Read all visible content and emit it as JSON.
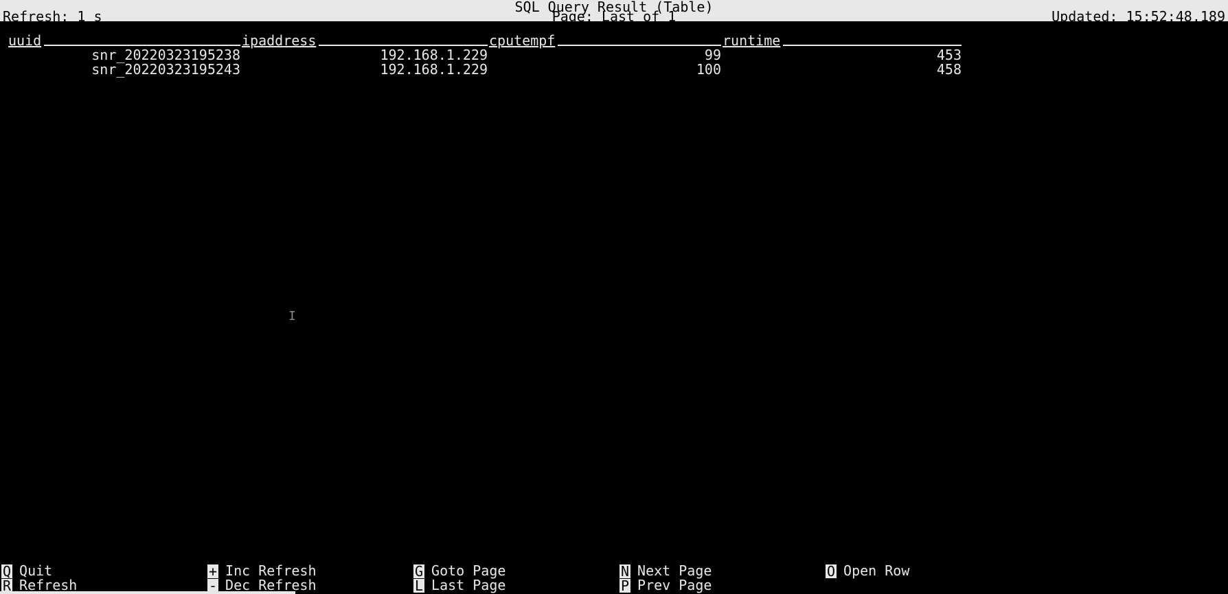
{
  "header": {
    "title": "SQL Query Result (Table)",
    "page": "Page: Last of 1",
    "refresh": "Refresh: 1 s",
    "updated": "Updated: 15:52:48.189"
  },
  "columns": [
    "uuid",
    "ipaddress",
    "cputempf",
    "runtime"
  ],
  "rows": [
    {
      "uuid": "snr_20220323195238",
      "ipaddress": "192.168.1.229",
      "cputempf": "99",
      "runtime": "453"
    },
    {
      "uuid": "snr_20220323195243",
      "ipaddress": "192.168.1.229",
      "cputempf": "100",
      "runtime": "458"
    }
  ],
  "footer": [
    {
      "key": "Q",
      "label": "Quit"
    },
    {
      "key": "R",
      "label": "Refresh"
    },
    {
      "key": "+",
      "label": "Inc Refresh"
    },
    {
      "key": "-",
      "label": "Dec Refresh"
    },
    {
      "key": "G",
      "label": "Goto Page"
    },
    {
      "key": "L",
      "label": "Last Page"
    },
    {
      "key": "N",
      "label": "Next Page"
    },
    {
      "key": "P",
      "label": "Prev Page"
    },
    {
      "key": "O",
      "label": "Open Row"
    },
    {
      "key": "",
      "label": ""
    }
  ],
  "cursor_glyph": "I"
}
